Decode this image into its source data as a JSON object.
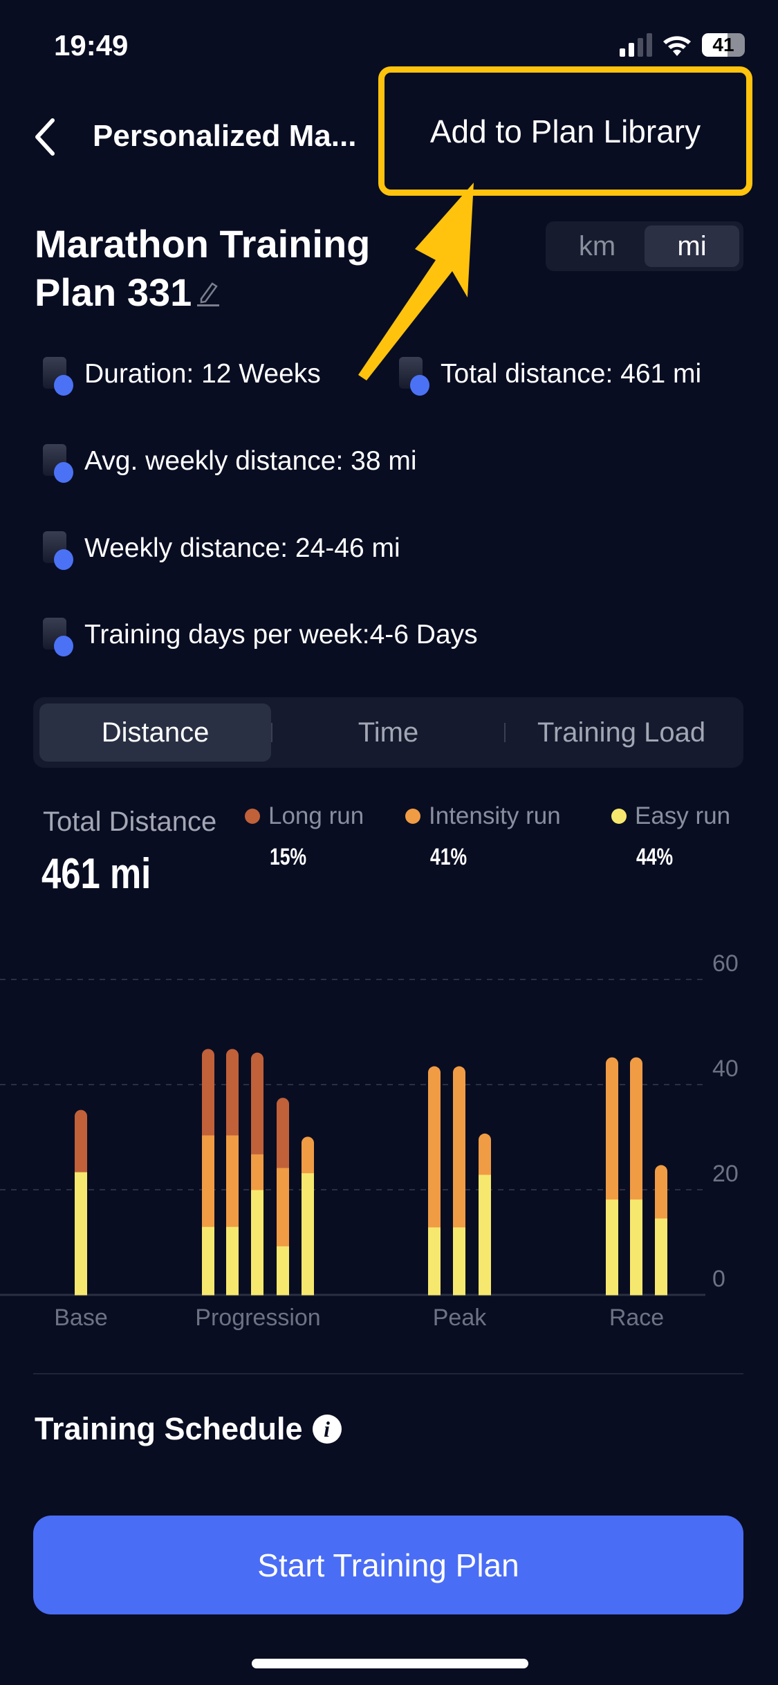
{
  "status_bar": {
    "time": "19:49",
    "battery": "41"
  },
  "nav": {
    "title": "Personalized Ma...",
    "add_button": "Add to Plan Library"
  },
  "plan": {
    "title_line1": "Marathon Training",
    "title_line2": "Plan 331"
  },
  "units": {
    "options": [
      "km",
      "mi"
    ],
    "selected": "mi"
  },
  "info": {
    "duration": "Duration: 12 Weeks",
    "total": "Total distance: 461 mi",
    "avg": "Avg. weekly distance: 38 mi",
    "weekly": "Weekly distance: 24-46 mi",
    "days": "Training days per week:4-6 Days"
  },
  "tabs": [
    {
      "label": "Distance",
      "selected": true
    },
    {
      "label": "Time"
    },
    {
      "label": "Training Load"
    }
  ],
  "summary": {
    "label": "Total Distance",
    "value": "461 mi"
  },
  "legend": [
    {
      "label": "Long run",
      "pct": "15%",
      "color": "#c0613a"
    },
    {
      "label": "Intensity run",
      "pct": "41%",
      "color": "#f09c45"
    },
    {
      "label": "Easy run",
      "pct": "44%",
      "color": "#f6e86e"
    }
  ],
  "chart_data": {
    "type": "bar",
    "stacked": true,
    "yticks": [
      "0",
      "20",
      "40",
      "60"
    ],
    "ylim": [
      0,
      60
    ],
    "grid": true,
    "phases": [
      {
        "label": "Base",
        "weeks": 1
      },
      {
        "label": "Progression",
        "weeks": 5
      },
      {
        "label": "Peak",
        "weeks": 3
      },
      {
        "label": "Race",
        "weeks": 3
      }
    ],
    "series": [
      {
        "name": "Easy run",
        "color": "#f6e86e",
        "values": [
          23.4,
          13,
          13,
          20,
          9.3,
          23.2,
          12.9,
          12.9,
          22.9,
          18.2,
          18.2,
          14.6
        ]
      },
      {
        "name": "Intensity run",
        "color": "#f09c45",
        "values": [
          0,
          17.4,
          17.4,
          6.8,
          14.9,
          5.7,
          29.4,
          29.4,
          6.6,
          25.8,
          25.8,
          8.9
        ]
      },
      {
        "name": "Long run",
        "color": "#c0613a",
        "values": [
          10.6,
          15.2,
          15.2,
          18.1,
          12.1,
          0,
          0,
          0,
          0,
          0,
          0,
          0
        ]
      }
    ]
  },
  "schedule": {
    "title": "Training Schedule"
  },
  "start_button": "Start Training Plan",
  "colors": {
    "accent": "#4a6df5",
    "highlight": "#ffc30e",
    "background": "#090d22"
  }
}
